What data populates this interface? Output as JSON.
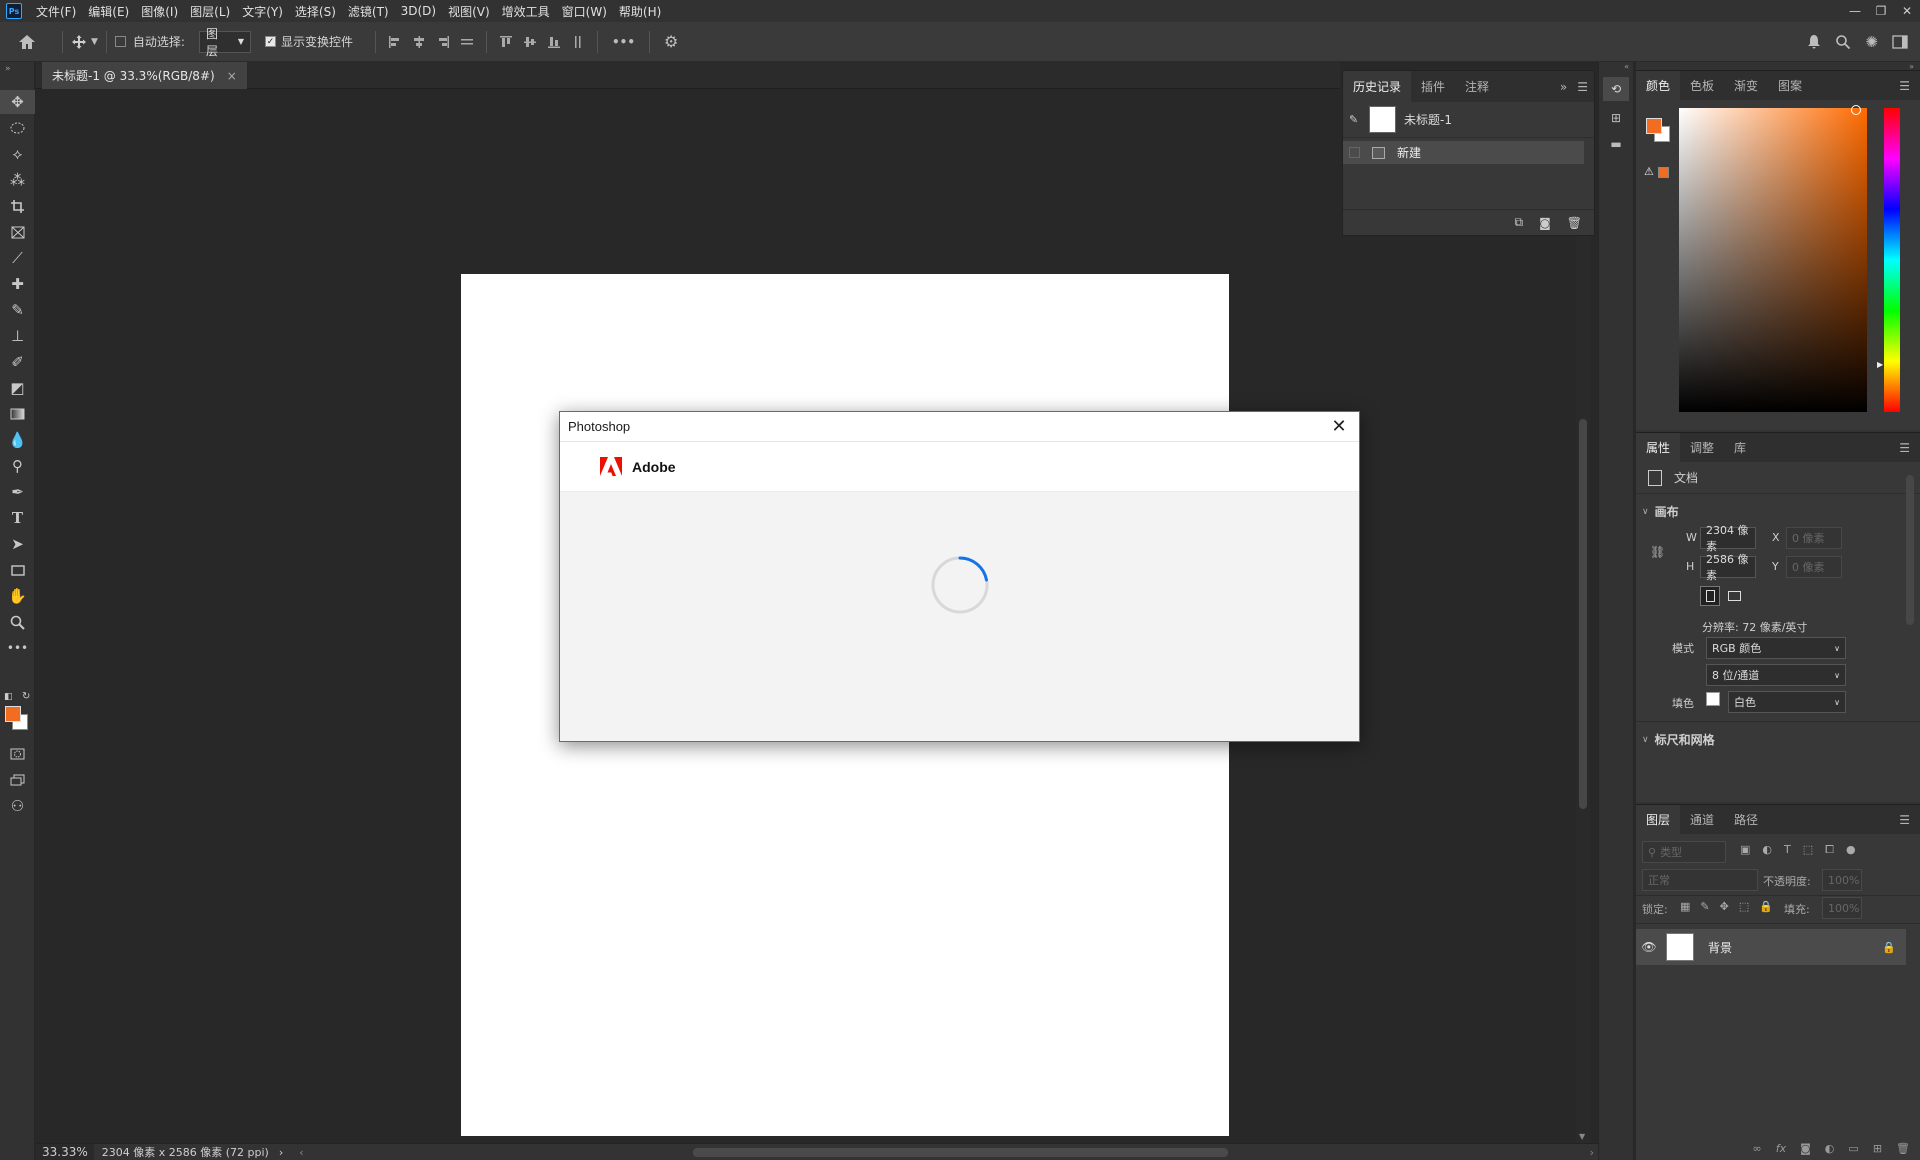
{
  "menu": [
    "文件(F)",
    "编辑(E)",
    "图像(I)",
    "图层(L)",
    "文字(Y)",
    "选择(S)",
    "滤镜(T)",
    "3D(D)",
    "视图(V)",
    "增效工具",
    "窗口(W)",
    "帮助(H)"
  ],
  "app_logo": "Ps",
  "options": {
    "auto_select_label": "自动选择:",
    "auto_select_value": "图层",
    "show_transform_label": "显示变换控件",
    "more": "•••"
  },
  "document": {
    "tab_title": "未标题-1 @ 33.3%(RGB/8#)",
    "close": "×"
  },
  "status": {
    "zoom": "33.33%",
    "info": "2304 像素 x 2586 像素 (72 ppi)",
    "arrow": "›"
  },
  "history_panel": {
    "tabs": [
      "历史记录",
      "插件",
      "注释"
    ],
    "snapshot_name": "未标题-1",
    "step_name": "新建"
  },
  "color_panel": {
    "tabs": [
      "颜色",
      "色板",
      "渐变",
      "图案"
    ],
    "foreground": "#f26d21",
    "background": "#ffffff"
  },
  "properties_panel": {
    "tabs": [
      "属性",
      "调整",
      "库"
    ],
    "doc_label": "文档",
    "canvas_section": "画布",
    "w_label": "W",
    "w_value": "2304 像素",
    "h_label": "H",
    "h_value": "2586 像素",
    "x_label": "X",
    "x_placeholder": "0 像素",
    "y_label": "Y",
    "y_placeholder": "0 像素",
    "resolution": "分辨率: 72 像素/英寸",
    "mode_label": "模式",
    "mode_value": "RGB 颜色",
    "depth_value": "8 位/通道",
    "fill_label": "填色",
    "fill_value": "白色",
    "rulers_section": "标尺和网格"
  },
  "layers_panel": {
    "tabs": [
      "图层",
      "通道",
      "路径"
    ],
    "filter_placeholder": "类型",
    "blend_mode": "正常",
    "opacity_label": "不透明度:",
    "opacity_value": "100%",
    "lock_label": "锁定:",
    "fill_label": "填充:",
    "fill_value": "100%",
    "layer_name": "背景"
  },
  "dialog": {
    "title": "Photoshop",
    "brand": "Adobe"
  }
}
